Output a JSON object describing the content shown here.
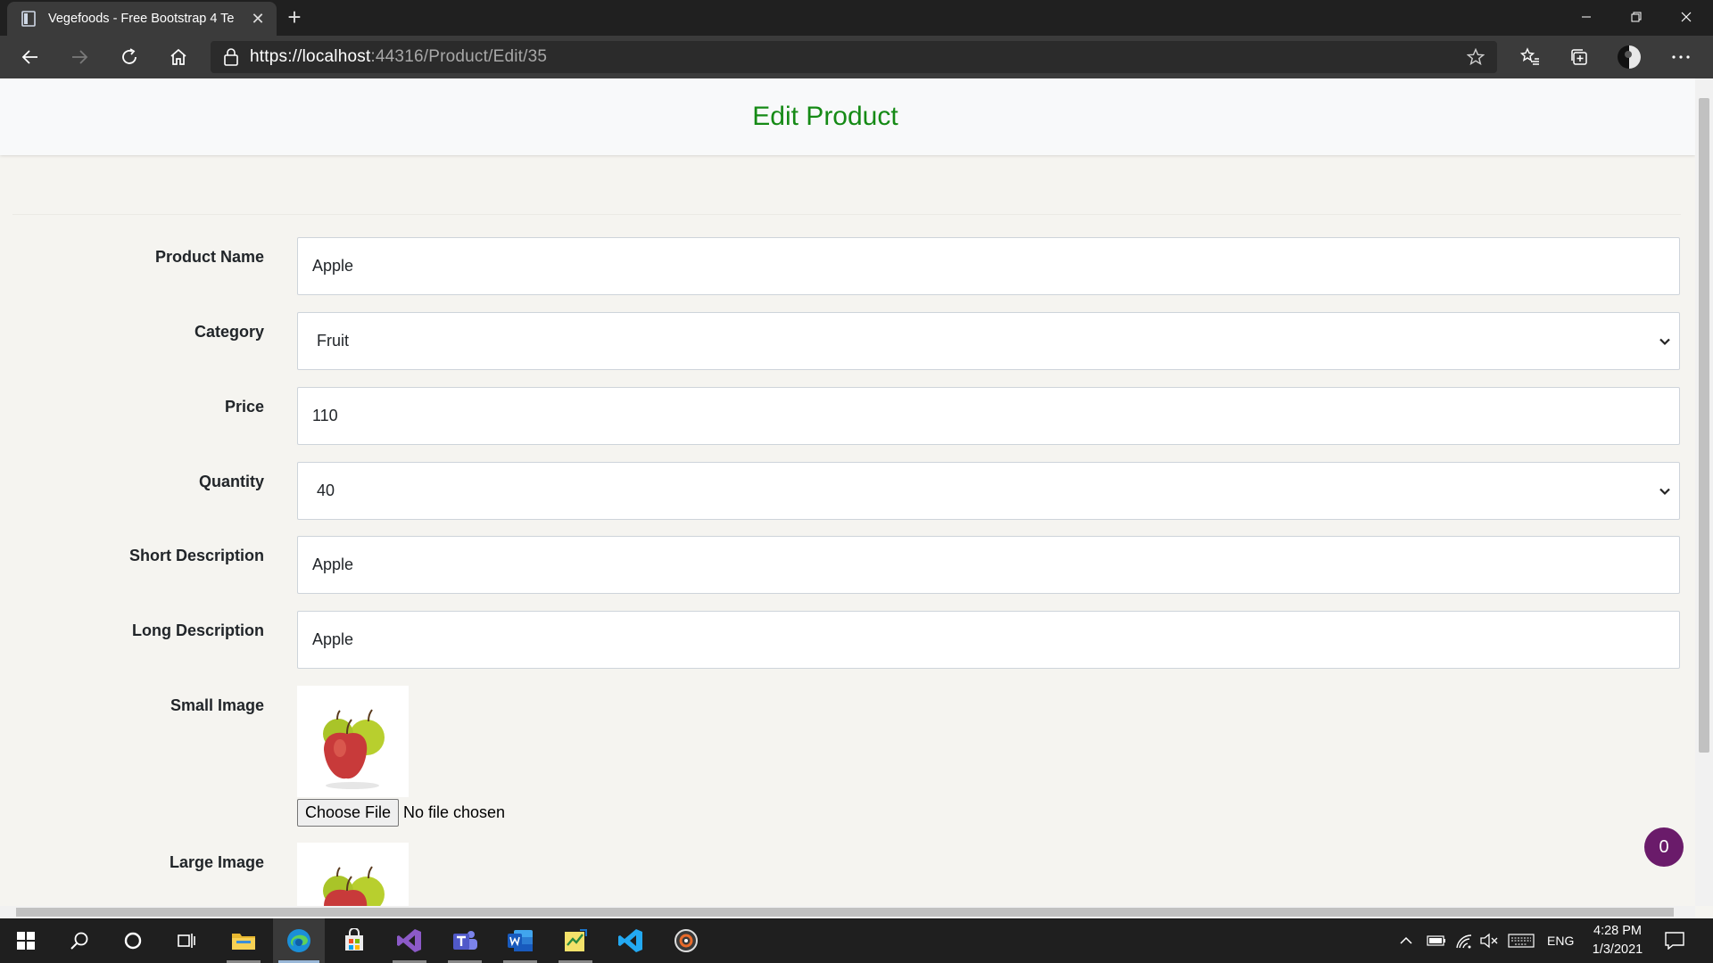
{
  "browser": {
    "tab_title": "Vegefoods - Free Bootstrap 4 Te",
    "url_host": "https://localhost",
    "url_path": ":44316/Product/Edit/35",
    "icons": [
      "back-icon",
      "forward-icon",
      "refresh-icon",
      "home-icon",
      "lock-icon",
      "favorite-star-icon",
      "favorites-icon",
      "collections-icon",
      "profile-avatar",
      "more-icon"
    ]
  },
  "page": {
    "title": "Edit Product",
    "title_color": "#158a15",
    "fields": {
      "product_name": {
        "label": "Product Name",
        "value": "Apple"
      },
      "category": {
        "label": "Category",
        "value": "Fruit"
      },
      "price": {
        "label": "Price",
        "value": "110"
      },
      "quantity": {
        "label": "Quantity",
        "value": "40"
      },
      "short_description": {
        "label": "Short Description",
        "value": "Apple"
      },
      "long_description": {
        "label": "Long Description",
        "value": "Apple"
      },
      "small_image": {
        "label": "Small Image",
        "button": "Choose File",
        "status": "No file chosen"
      },
      "large_image": {
        "label": "Large Image"
      }
    },
    "cart_badge": "0",
    "badge_color": "#6a1b6a"
  },
  "taskbar": {
    "icons": [
      "windows-start-icon",
      "search-icon",
      "cortana-icon",
      "task-view-icon",
      "file-explorer-icon",
      "edge-icon",
      "store-icon",
      "visual-studio-icon",
      "teams-icon",
      "word-icon",
      "sticky-app-icon",
      "vscode-icon",
      "media-app-icon"
    ],
    "language": "ENG",
    "time": "4:28 PM",
    "date": "1/3/2021"
  }
}
